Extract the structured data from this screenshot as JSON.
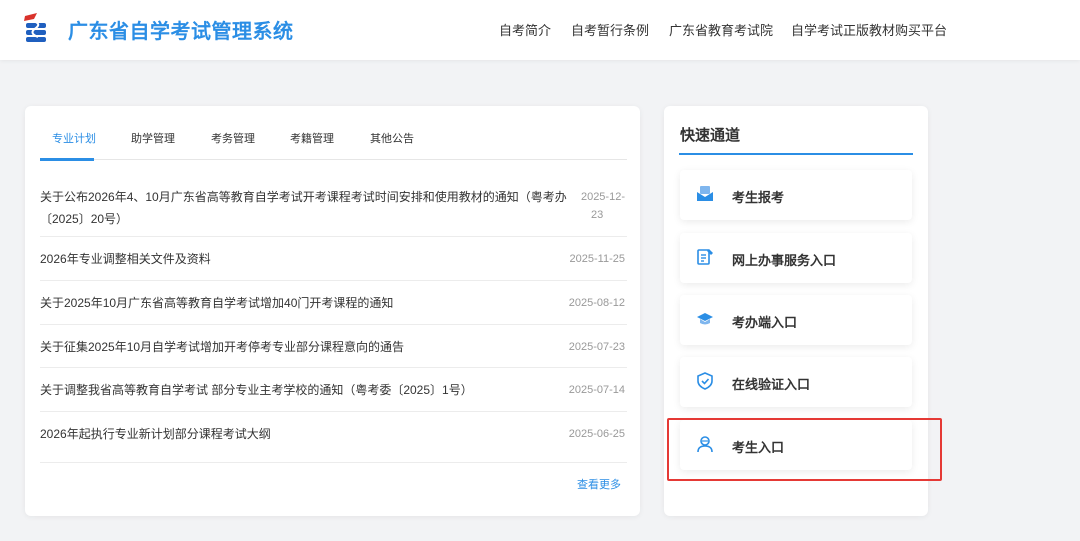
{
  "header": {
    "site_title": "广东省自学考试管理系统",
    "nav": [
      "自考简介",
      "自考暂行条例",
      "广东省教育考试院",
      "自学考试正版教材购买平台"
    ]
  },
  "news": {
    "tabs": [
      "专业计划",
      "助学管理",
      "考务管理",
      "考籍管理",
      "其他公告"
    ],
    "active_tab": "专业计划",
    "items": [
      {
        "title": "关于公布2026年4、10月广东省高等教育自学考试开考课程考试时间安排和使用教材的通知（粤考办〔2025〕20号）",
        "date_line1": "2025-12-",
        "date_line2": "23"
      },
      {
        "title": "2026年专业调整相关文件及资料",
        "date": "2025-11-25"
      },
      {
        "title": "关于2025年10月广东省高等教育自学考试增加40门开考课程的通知",
        "date": "2025-08-12"
      },
      {
        "title": "关于征集2025年10月自学考试增加开考停考专业部分课程意向的通告",
        "date": "2025-07-23"
      },
      {
        "title": "关于调整我省高等教育自学考试 部分专业主考学校的通知（粤考委〔2025〕1号）",
        "date": "2025-07-14"
      },
      {
        "title": "2026年起执行专业新计划部分课程考试大纲",
        "date": "2025-06-25"
      }
    ],
    "more_label": "查看更多"
  },
  "quick": {
    "title": "快速通道",
    "entries": [
      {
        "label": "考生报考",
        "icon": "mail-icon"
      },
      {
        "label": "网上办事服务入口",
        "icon": "document-edit-icon"
      },
      {
        "label": "考办端入口",
        "icon": "graduation-cap-icon"
      },
      {
        "label": "在线验证入口",
        "icon": "shield-check-icon"
      },
      {
        "label": "考生入口",
        "icon": "user-icon"
      }
    ]
  },
  "colors": {
    "accent": "#2b8ee5",
    "highlight": "#e53935",
    "background": "#f2f3f5"
  }
}
